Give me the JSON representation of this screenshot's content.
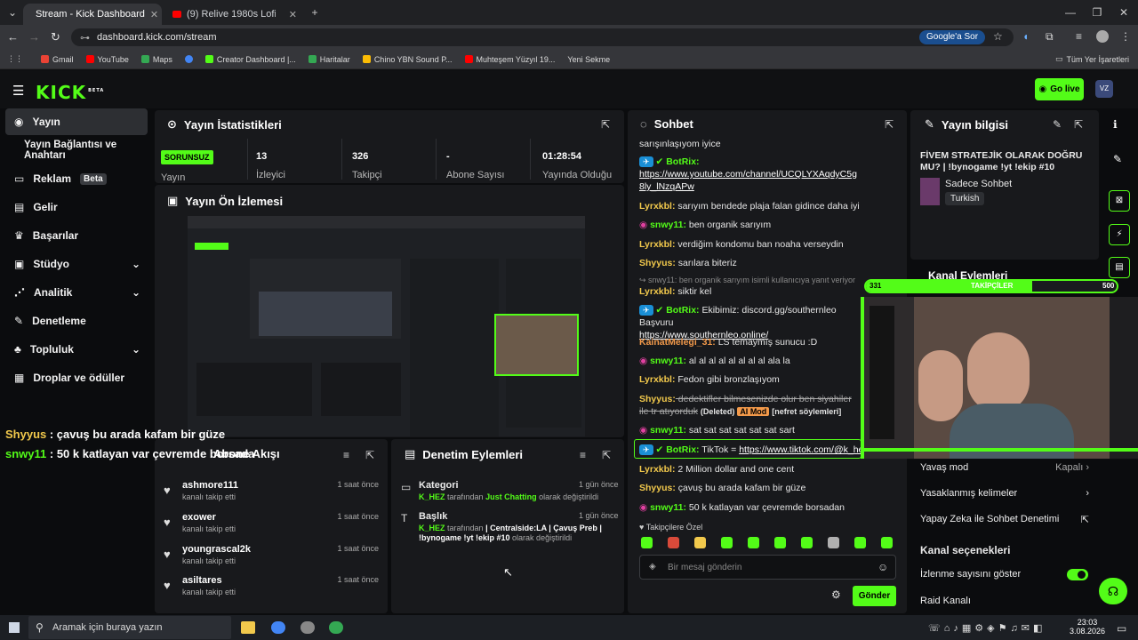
{
  "browser": {
    "tabs": [
      "Stream - Kick Dashboard",
      "(9) Relive 1980s Lofi City Vi"
    ],
    "url": "dashboard.kick.com/stream",
    "google_btn": "Google'a Sor",
    "bookmarks": [
      "Gmail",
      "YouTube",
      "Maps",
      "Creator Dashboard |...",
      "Haritalar",
      "Chino YBN Sound P...",
      "Muhteşem Yüzyıl 19...",
      "Yeni Sekme"
    ],
    "all_bookmarks": "Tüm Yer İşaretleri"
  },
  "kick": {
    "logo": "KICK",
    "logo_beta": "BETA",
    "go_live": "Go live",
    "sidebar": [
      {
        "label": "Yayın",
        "icon": "broadcast-icon"
      },
      {
        "label": "Yayın Bağlantısı ve Anahtarı",
        "icon": ""
      },
      {
        "label": "Reklam",
        "icon": "ad-icon",
        "badge": "Beta"
      },
      {
        "label": "Gelir",
        "icon": "revenue-icon"
      },
      {
        "label": "Başarılar",
        "icon": "trophy-icon"
      },
      {
        "label": "Stüdyo",
        "icon": "studio-icon"
      },
      {
        "label": "Analitik",
        "icon": "analytics-icon"
      },
      {
        "label": "Denetleme",
        "icon": "wrench-icon"
      },
      {
        "label": "Topluluk",
        "icon": "community-icon"
      },
      {
        "label": "Droplar ve ödüller",
        "icon": "drops-icon"
      }
    ],
    "stats": {
      "title": "Yayın İstatistikleri",
      "status": "SORUNSUZ",
      "status_label": "Yayın",
      "items": [
        {
          "value": "13",
          "label": "İzleyici"
        },
        {
          "value": "326",
          "label": "Takipçi"
        },
        {
          "value": "-",
          "label": "Abone Sayısı"
        },
        {
          "value": "01:28:54",
          "label": "Yayında Olduğu"
        }
      ]
    },
    "preview": {
      "title": "Yayın Ön İzlemesi"
    },
    "follows": {
      "title": "Abone Akışı",
      "rows": [
        {
          "name": "ashmore111",
          "action": "kanalı takip etti",
          "time": "1 saat önce"
        },
        {
          "name": "exower",
          "action": "kanalı takip etti",
          "time": "1 saat önce"
        },
        {
          "name": "youngrascal2k",
          "action": "kanalı takip etti",
          "time": "1 saat önce"
        },
        {
          "name": "asiltares",
          "action": "kanalı takip etti",
          "time": "1 saat önce"
        }
      ]
    },
    "overlay_chat": [
      {
        "user": "Shyyus",
        "text": " : çavuş bu arada kafam bir güze"
      },
      {
        "user": "snwy11",
        "text": " : 50 k katlayan var çevremde borsada"
      }
    ],
    "moderation": {
      "title": "Denetim Eylemleri",
      "items": [
        {
          "title": "Kategori",
          "time": "1 gün önce",
          "user": "K_HEZ",
          "by": "tarafından",
          "value": "Just Chatting",
          "suffix": "olarak değiştirildi"
        },
        {
          "title": "Başlık",
          "time": "1 gün önce",
          "user": "K_HEZ",
          "by": "tarafından",
          "value": "| Centralside:LA | Çavuş Preb | !bynogame !yt !ekip #10",
          "suffix": "olarak değiştirildi"
        }
      ]
    },
    "chat": {
      "title": "Sohbet",
      "lines": [
        {
          "user": "",
          "text": "sarışınlaşıyom iyice"
        },
        {
          "user": "BotRix:",
          "text": "",
          "link": "https://www.youtube.com/channel/UCQLYXAqdyC5g8ly_lNzqAPw"
        },
        {
          "user": "Lyrxkbl:",
          "text": " sarıyım bendede plaja falan gidince daha iyi"
        },
        {
          "user": "snwy11:",
          "text": " ben organik sarıyım"
        },
        {
          "user": "Lyrxkbl:",
          "text": " verdiğim kondomu ban noaha verseydin"
        },
        {
          "user": "Shyyus:",
          "text": " sarılara biteriz"
        },
        {
          "user": "",
          "text": "↪ snwy11: ben organik sarıyım isimli kullanıcıya yanıt veriyor"
        },
        {
          "user": "Lyrxkbl:",
          "text": " siktir kel"
        },
        {
          "user": "BotRix:",
          "text": " Ekibimiz: discord.gg/southernleo Başvuru",
          "link": "https://www.southernleo.online/"
        },
        {
          "user": "KainatMelegi_31:",
          "text": " LS temaymış sunucu :D"
        },
        {
          "user": "snwy11:",
          "text": " al al al al al al al al ala la"
        },
        {
          "user": "Lyrxkbl:",
          "text": " Fedon gibi bronzlaşıyom"
        },
        {
          "user": "Shyyus:",
          "text": " dedektifler bilmesenizde olur ben siyahiler ile tr atıyorduk",
          "deleted": "(Deleted)",
          "ai": "AI Mod",
          "reason": "[nefret söylemleri]"
        },
        {
          "user": "snwy11:",
          "text": " sat sat sat sat sat sat sart"
        },
        {
          "user": "BotRix:",
          "text": " TikTok = ",
          "link": "https://www.tiktok.com/@k_hez"
        },
        {
          "user": "Lyrxkbl:",
          "text": " 2 Million dollar and one cent"
        },
        {
          "user": "Shyyus:",
          "text": " çavuş bu arada kafam bir güze"
        },
        {
          "user": "snwy11:",
          "text": " 50 k katlayan var çevremde borsadan"
        }
      ],
      "followers_only": "Takipçilere Özel",
      "input_placeholder": "Bir mesaj gönderin",
      "send": "Gönder"
    },
    "stream_info": {
      "title": "Yayın bilgisi",
      "stream_title": "FİVEM STRATEJİK OLARAK DOĞRU MU? | !bynogame !yt !ekip #10",
      "category": "Sadece Sohbet",
      "language": "Turkish"
    },
    "channel_actions": {
      "title": "Kanal Eylemleri"
    },
    "follower_goal": {
      "label": "TAKİPÇİLER",
      "current": "331",
      "target": "500",
      "progress": 0.662
    },
    "settings": {
      "rows": [
        {
          "label": "Yavaş mod",
          "value": "Kapalı"
        },
        {
          "label": "Yasaklanmış kelimeler",
          "value": ""
        },
        {
          "label": "Yapay Zeka ile Sohbet Denetimi",
          "value": ""
        }
      ],
      "channel_options": "Kanal seçenekleri",
      "view_count": "İzlenme sayısını göster",
      "raid": "Raid Kanalı"
    }
  },
  "taskbar": {
    "search": "Aramak için buraya yazın",
    "time": "23:03",
    "date": "3.08.2026"
  }
}
